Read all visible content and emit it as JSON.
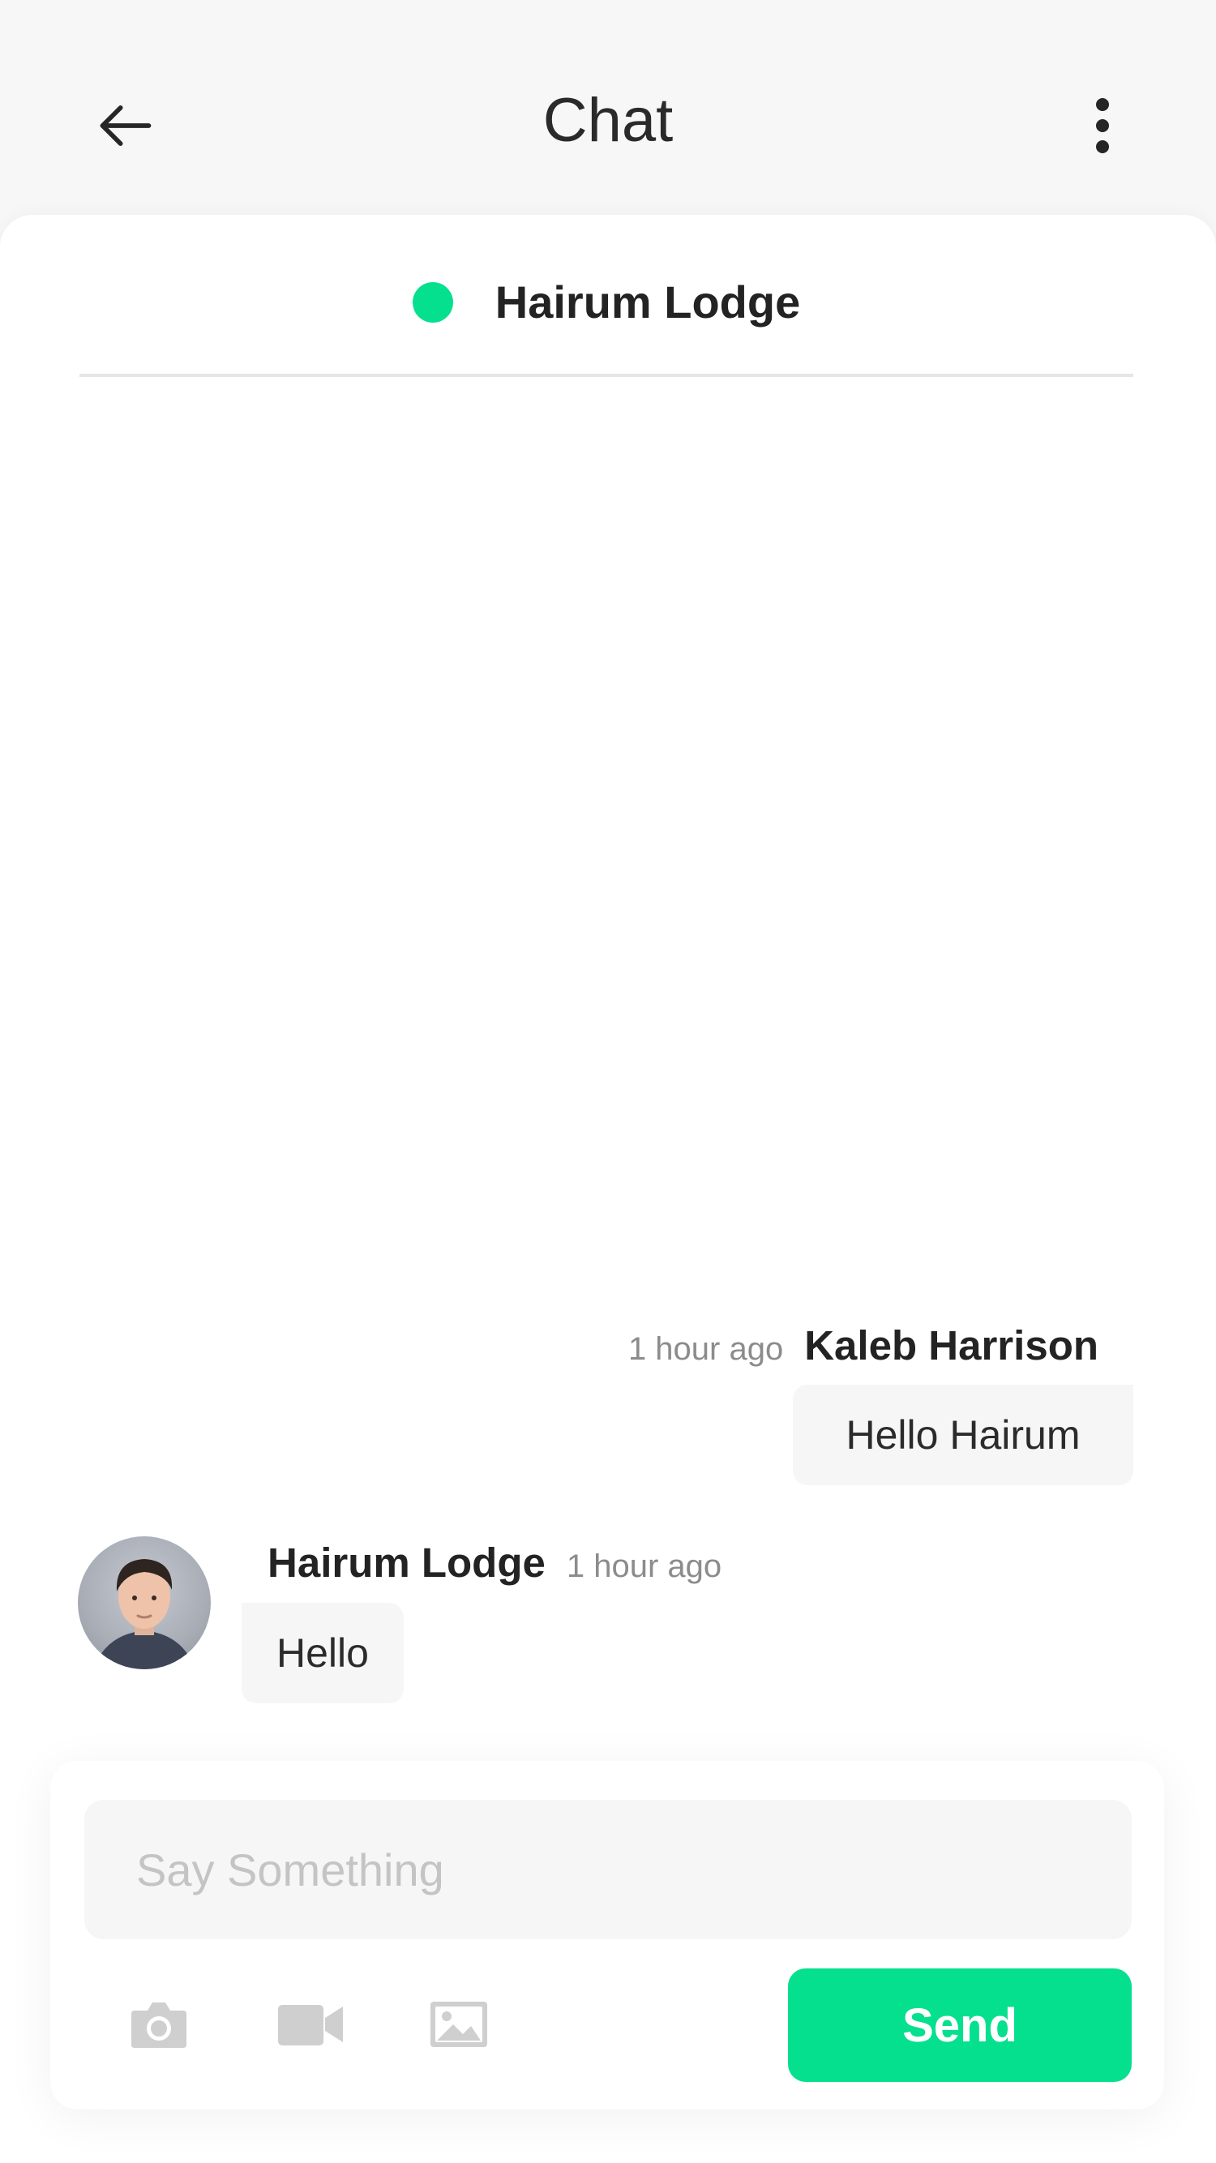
{
  "header": {
    "title": "Chat",
    "back_icon": "arrow-left-icon",
    "menu_icon": "more-vertical-icon"
  },
  "contact": {
    "name": "Hairum Lodge",
    "status_color": "#05e08f"
  },
  "messages": [
    {
      "direction": "outgoing",
      "sender": "Kaleb Harrison",
      "time": "1 hour ago",
      "text": "Hello Hairum"
    },
    {
      "direction": "incoming",
      "sender": "Hairum Lodge",
      "time": "1 hour ago",
      "text": "Hello"
    }
  ],
  "composer": {
    "placeholder": "Say Something",
    "value": "",
    "tools": [
      "camera-icon",
      "video-icon",
      "image-icon"
    ],
    "send_label": "Send",
    "accent": "#05e08f"
  }
}
